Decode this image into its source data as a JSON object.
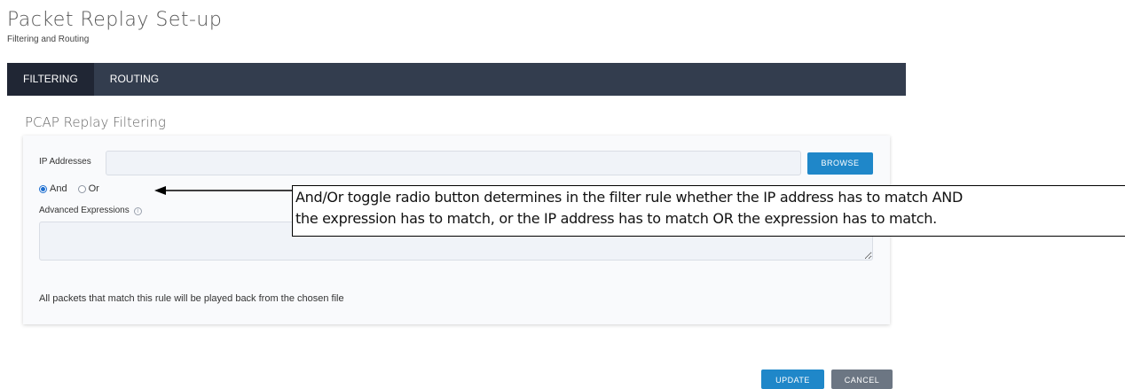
{
  "header": {
    "title": "Packet Replay Set-up",
    "subtitle": "Filtering and Routing"
  },
  "tabs": [
    {
      "label": "FILTERING",
      "active": true
    },
    {
      "label": "ROUTING",
      "active": false
    }
  ],
  "section": {
    "title": "PCAP Replay Filtering"
  },
  "form": {
    "ip_label": "IP Addresses",
    "ip_value": "",
    "browse_label": "BROWSE",
    "radio_and": "And",
    "radio_or": "Or",
    "radio_selected": "And",
    "advanced_label": "Advanced Expressions",
    "advanced_value": "",
    "helper_text": "All packets that match this rule will be played back from the chosen file"
  },
  "actions": {
    "update_label": "UPDATE",
    "cancel_label": "CANCEL"
  },
  "annotation": {
    "line1": "And/Or toggle radio button determines in the filter rule whether the IP address has to match AND",
    "line2": "the expression has to match, or the IP address has to match OR the expression has to match."
  },
  "icons": {
    "info": "info-icon"
  },
  "colors": {
    "tabbar": "#333d4e",
    "tab_active": "#202634",
    "primary": "#1f87c9",
    "secondary": "#6c7683"
  }
}
